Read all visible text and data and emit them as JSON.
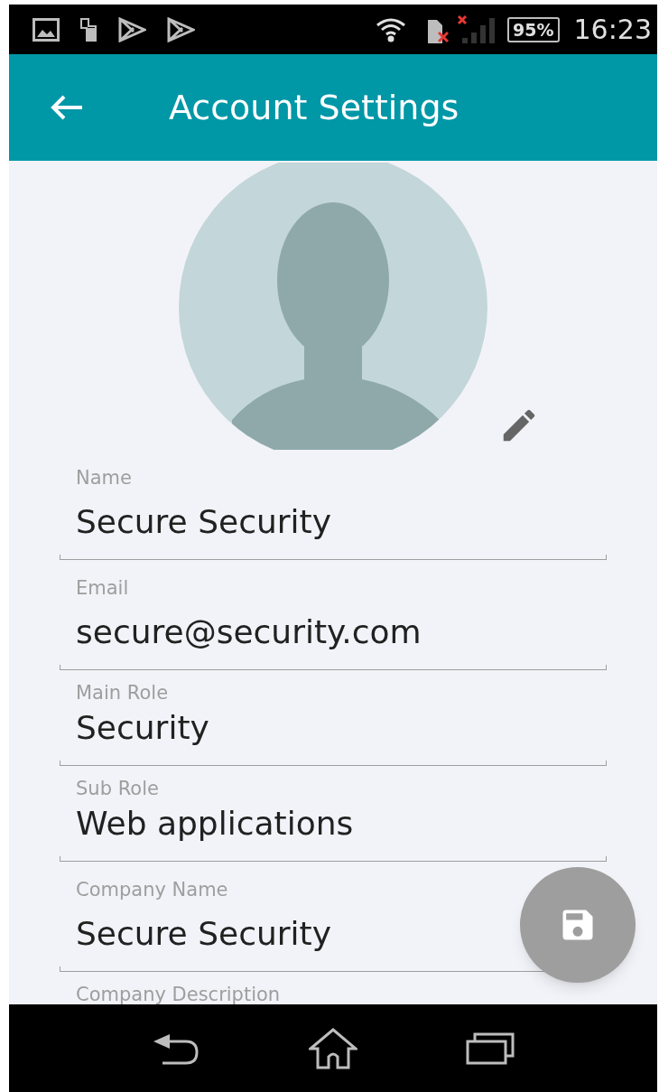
{
  "status_bar": {
    "battery": "95%",
    "time": "16:23"
  },
  "app_bar": {
    "title": "Account Settings"
  },
  "fields": [
    {
      "label": "Name",
      "value": "Secure Security"
    },
    {
      "label": "Email",
      "value": "secure@security.com"
    },
    {
      "label": "Main Role",
      "value": "Security"
    },
    {
      "label": "Sub Role",
      "value": "Web applications"
    },
    {
      "label": "Company Name",
      "value": "Secure Security"
    },
    {
      "label": "Company Description"
    }
  ]
}
